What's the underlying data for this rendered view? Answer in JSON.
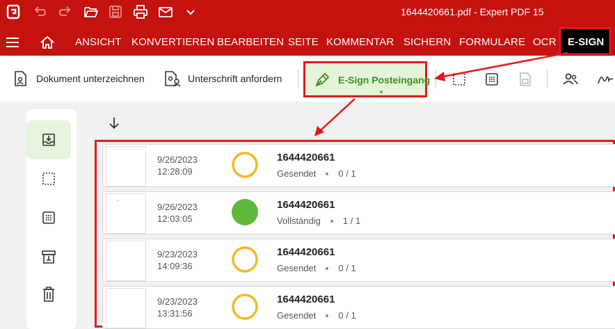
{
  "title_bar": {
    "title": "1644420661.pdf  -  Expert PDF 15",
    "icons": [
      "app-logo-icon",
      "undo-icon",
      "redo-icon",
      "open-folder-icon",
      "save-icon",
      "print-icon",
      "mail-icon",
      "chevron-down-icon"
    ]
  },
  "menu": {
    "items": [
      "ANSICHT",
      "KONVERTIEREN",
      "BEARBEITEN",
      "SEITE",
      "KOMMENTAR",
      "SICHERN",
      "FORMULARE",
      "OCR",
      "E-SIGN"
    ],
    "active": "E-SIGN"
  },
  "ribbon": {
    "sign_document": "Dokument unterzeichnen",
    "request_signature": "Unterschrift anfordern",
    "esign_inbox": "E-Sign Posteingang"
  },
  "documents": [
    {
      "date": "9/26/2023",
      "time": "12:28:09",
      "title": "1644420661",
      "status": "Gesendet",
      "count": "0 / 1",
      "state": "pending"
    },
    {
      "date": "9/26/2023",
      "time": "12:03:05",
      "title": "1644420661",
      "status": "Vollständig",
      "count": "1 / 1",
      "state": "complete"
    },
    {
      "date": "9/23/2023",
      "time": "14:09:36",
      "title": "1644420661",
      "status": "Gesendet",
      "count": "0 / 1",
      "state": "pending"
    },
    {
      "date": "9/23/2023",
      "time": "13:31:56",
      "title": "1644420661",
      "status": "Gesendet",
      "count": "0 / 1",
      "state": "pending"
    }
  ],
  "colors": {
    "brand_red": "#c4120f",
    "highlight_red": "#e11b1b",
    "accent_green": "#3b8f1f",
    "pending_ring": "#f5b820",
    "complete_fill": "#5cb83a"
  }
}
